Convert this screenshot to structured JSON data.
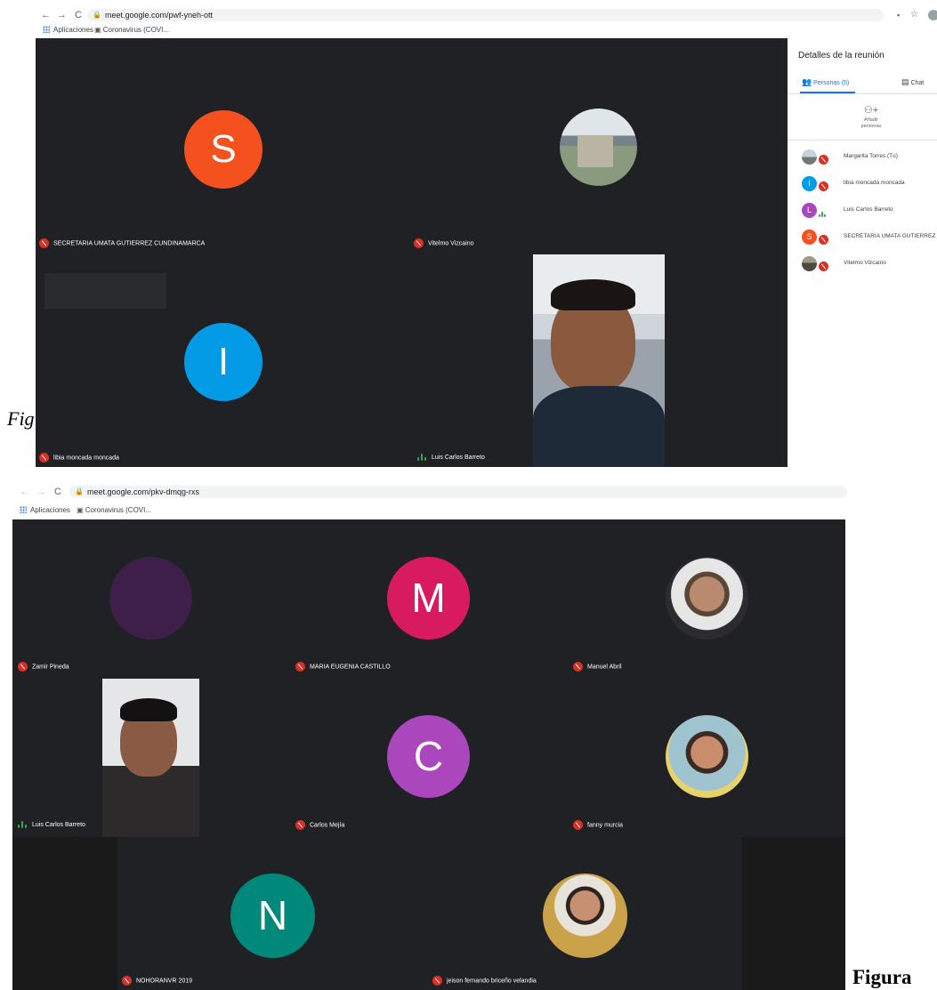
{
  "screenshot1": {
    "url": "meet.google.com/pwf-yneh-ott",
    "bookmarks": [
      "Aplicaciones",
      "Coronavirus (COVI..."
    ],
    "tiles": [
      {
        "name": "SECRETARIA UMATA GUTIERREZ CUNDINAMARCA",
        "initial": "S",
        "color": "#f4511e",
        "muted": true
      },
      {
        "name": "Vitelmo Vizcaino",
        "initial": "",
        "color": "#8a9a7e",
        "muted": true
      },
      {
        "name": "libia moncada moncada",
        "initial": "I",
        "color": "#039be5",
        "muted": true
      },
      {
        "name": "Luis Carlos Barreto",
        "initial": "",
        "color": "",
        "muted": false
      }
    ],
    "panel": {
      "title": "Detalles de la reunión",
      "tab_people": "Personas (5)",
      "tab_chat": "Chat",
      "add_people": "Añadir\npersonas",
      "people": [
        {
          "name": "Margarita Torres (Tú)",
          "initial": "",
          "color": "#7c8a96",
          "muted": true
        },
        {
          "name": "libia moncada moncada",
          "initial": "I",
          "color": "#039be5",
          "muted": true
        },
        {
          "name": "Luis Carlos Barreto",
          "initial": "L",
          "color": "#ab47bc",
          "muted": false
        },
        {
          "name": "SECRETARIA UMATA GUTIERREZ",
          "initial": "S",
          "color": "#f4511e",
          "muted": true
        },
        {
          "name": "Vitelmo Vizcaino",
          "initial": "",
          "color": "#6d6d5b",
          "muted": true
        }
      ]
    }
  },
  "caption_left": "Fig",
  "screenshot2": {
    "url": "meet.google.com/pkv-dmqg-rxs",
    "bookmarks": [
      "Aplicaciones",
      "Coronavirus (COVI..."
    ],
    "tiles": [
      {
        "name": "Zamir Pineda",
        "initial": "",
        "color": "#3d1f4a",
        "muted": true
      },
      {
        "name": "MARIA EUGENIA CASTILLO",
        "initial": "M",
        "color": "#d81b60",
        "muted": true
      },
      {
        "name": "Manuel Abril",
        "initial": "",
        "color": "#8d7b6a",
        "muted": true
      },
      {
        "name": "Luis Carlos Barreto",
        "initial": "",
        "color": "",
        "muted": false
      },
      {
        "name": "Carlos Mejía",
        "initial": "C",
        "color": "#ab47bc",
        "muted": true
      },
      {
        "name": "fanny murcia",
        "initial": "",
        "color": "#9fc3cf",
        "muted": true
      },
      {
        "name": "NOHORANVR 2019",
        "initial": "N",
        "color": "#00897b",
        "muted": true
      },
      {
        "name": "jeison fernando briceño velandia",
        "initial": "",
        "color": "#c9a24a",
        "muted": true
      }
    ]
  },
  "caption_right": "Figura"
}
